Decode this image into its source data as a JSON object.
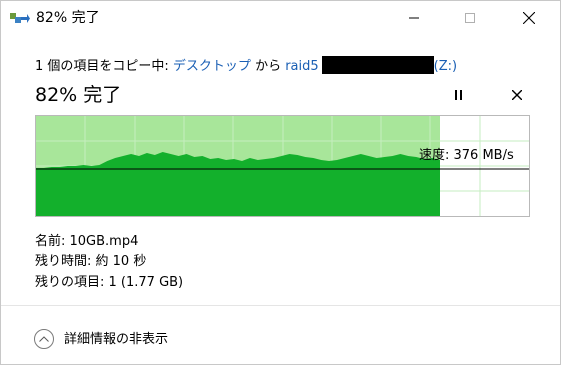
{
  "window": {
    "title": "82% 完了",
    "icon": "copy-arrow-icon"
  },
  "copy_status": {
    "prefix": "1 個の項目をコピー中: ",
    "source": "デスクトップ",
    "middle": " から ",
    "destination": "raid5",
    "drive": "(Z:)"
  },
  "progress": {
    "percent": 82,
    "title": "82% 完了",
    "speed_label": "速度: 376 MB/s"
  },
  "info": {
    "name": "名前: 10GB.mp4",
    "time_remaining": "残り時間: 約 10 秒",
    "items_remaining": "残りの項目: 1 (1.77 GB)"
  },
  "details_toggle": {
    "label": "詳細情報の非表示",
    "icon": "chevron-up-icon"
  },
  "colors": {
    "graph_bg_filled": "#a8e69a",
    "graph_fill": "#13b02c",
    "grid": "#c6eec0",
    "speed_line": "#000000"
  }
}
